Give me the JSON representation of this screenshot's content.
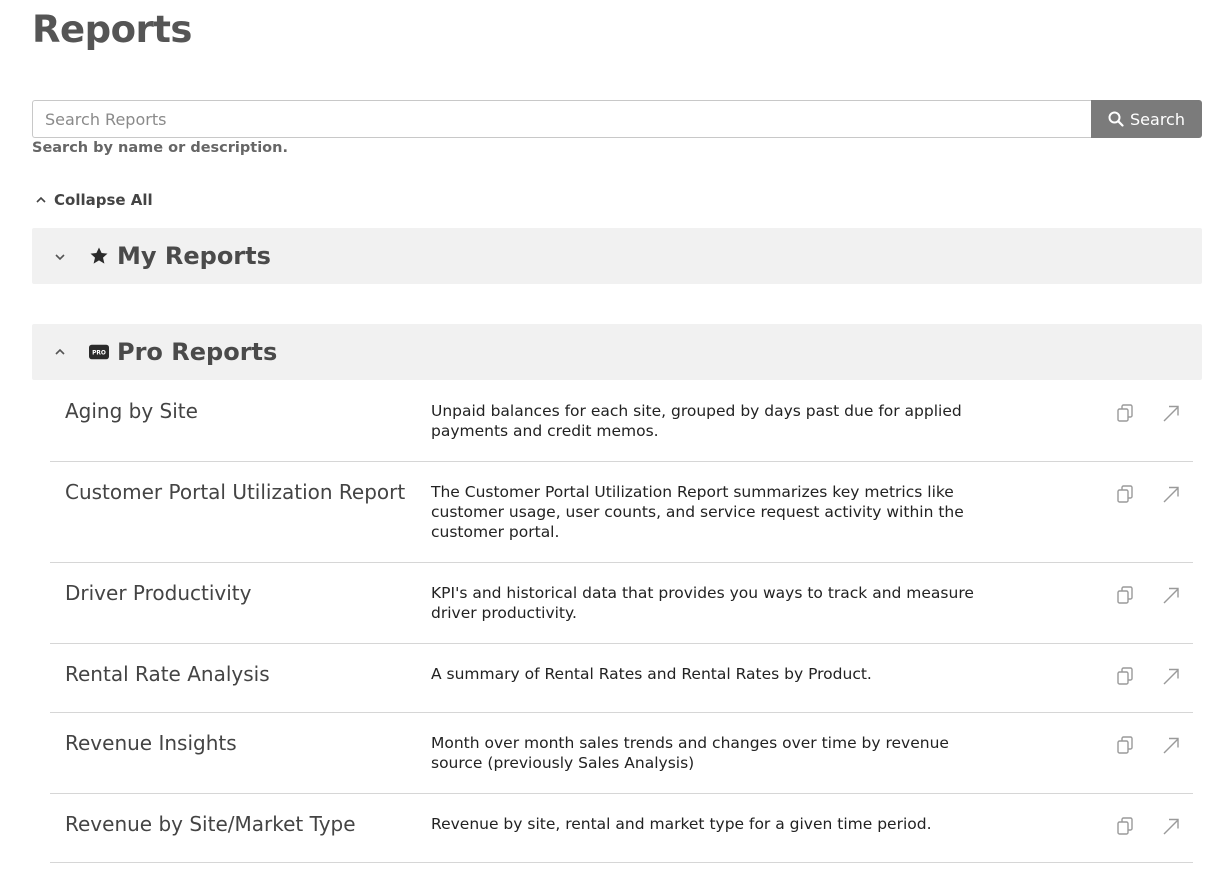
{
  "page": {
    "title": "Reports"
  },
  "search": {
    "placeholder": "Search Reports",
    "button_label": "Search",
    "hint": "Search by name or description."
  },
  "collapse_all": {
    "label": "Collapse All"
  },
  "sections": {
    "my_reports": {
      "title": "My Reports",
      "icon": "star-icon",
      "expanded": false
    },
    "pro_reports": {
      "title": "Pro Reports",
      "icon": "pro-badge-icon",
      "icon_text": "PRO",
      "expanded": true
    }
  },
  "reports": [
    {
      "name": "Aging by Site",
      "description": "Unpaid balances for each site, grouped by days past due for applied payments and credit memos."
    },
    {
      "name": "Customer Portal Utilization Report",
      "description": "The Customer Portal Utilization Report summarizes key metrics like customer usage, user counts, and service request activity within the customer portal."
    },
    {
      "name": "Driver Productivity",
      "description": "KPI's and historical data that provides you ways to track and measure driver productivity."
    },
    {
      "name": "Rental Rate Analysis",
      "description": "A summary of Rental Rates and Rental Rates by Product."
    },
    {
      "name": "Revenue Insights",
      "description": "Month over month sales trends and changes over time by revenue source (previously Sales Analysis)"
    },
    {
      "name": "Revenue by Site/Market Type",
      "description": "Revenue by site, rental and market type for a given time period."
    }
  ],
  "row_icons": [
    "copy-icon",
    "open-external-icon"
  ],
  "colors": {
    "search_button": "#7b7b7b",
    "section_bg": "#f1f1f1",
    "divider": "#d6d6d6"
  }
}
